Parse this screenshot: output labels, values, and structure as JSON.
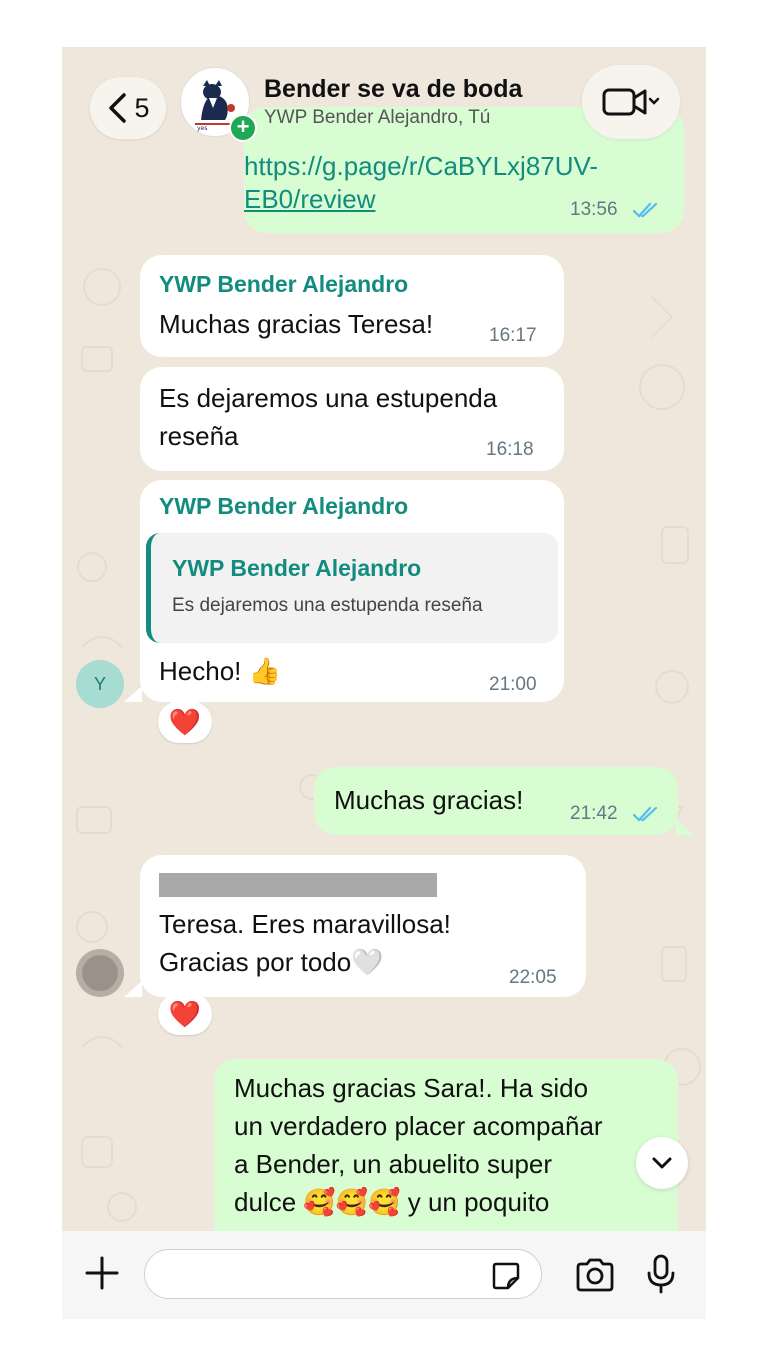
{
  "header": {
    "back_count": "5",
    "title": "Bender se va de boda",
    "subtitle": "YWP Bender Alejandro, Tú"
  },
  "messages": [
    {
      "type": "out",
      "link_line1": "https://g.page/r/CaBYLxj87UV-",
      "link_line2": "EB0/review",
      "time": "13:56",
      "status": "read"
    },
    {
      "type": "in",
      "sender": "YWP Bender Alejandro",
      "text": "Muchas gracias Teresa!",
      "time": "16:17"
    },
    {
      "type": "in",
      "text_line1": "Es dejaremos una estupenda",
      "text_line2": "reseña",
      "time": "16:18"
    },
    {
      "type": "in",
      "sender": "YWP Bender Alejandro",
      "quote_sender": "YWP Bender Alejandro",
      "quote_text": "Es dejaremos una estupenda reseña",
      "text": "Hecho! 👍",
      "time": "21:00",
      "reaction": "❤️",
      "avatar_letter": "Y"
    },
    {
      "type": "out",
      "text": "Muchas gracias!",
      "time": "21:42",
      "status": "read"
    },
    {
      "type": "in",
      "text_line1": "Teresa. Eres maravillosa!",
      "text_line2": "Gracias por todo🤍",
      "time": "22:05",
      "reaction": "❤️"
    },
    {
      "type": "out",
      "text_line1": "Muchas gracias Sara!. Ha sido",
      "text_line2": "un verdadero placer acompañar",
      "text_line3": "a Bender, un abuelito super",
      "text_line4": "dulce 🥰🥰🥰 y un poquito"
    }
  ],
  "colors": {
    "chat_bg": "#efe7dc",
    "incoming": "#ffffff",
    "outgoing": "#d9fdd3",
    "sender_name": "#128c7e",
    "read_ticks": "#53bdeb",
    "avatar_y": "#a7dcd3"
  },
  "icons": {
    "back": "chevron-left-icon",
    "video": "video-camera-icon",
    "plus": "plus-icon",
    "sticker": "sticker-icon",
    "camera": "camera-icon",
    "mic": "microphone-icon",
    "scroll": "chevron-down-icon"
  }
}
